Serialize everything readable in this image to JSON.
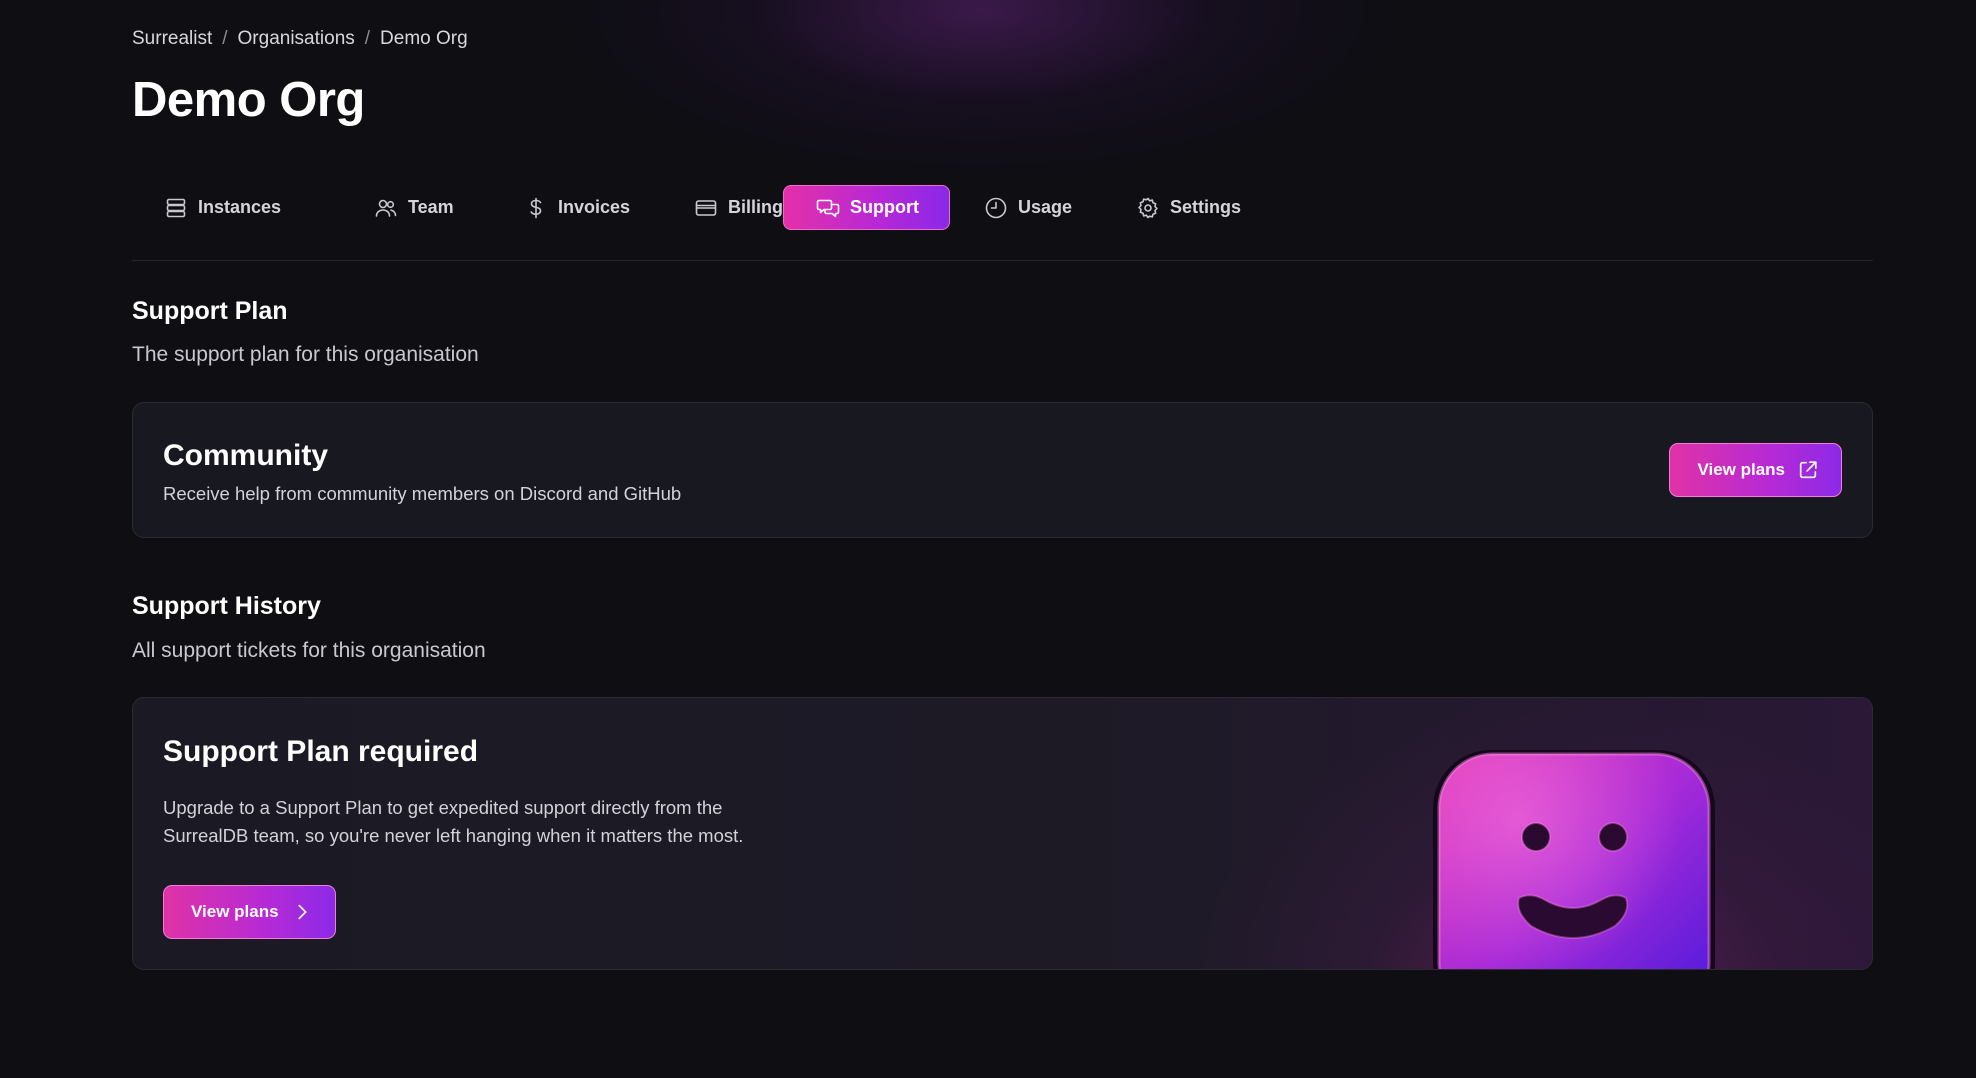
{
  "breadcrumb": {
    "items": [
      "Surrealist",
      "Organisations",
      "Demo Org"
    ],
    "separator": "/"
  },
  "page_title": "Demo Org",
  "tabs": [
    {
      "label": "Instances",
      "icon": "server-stack-icon",
      "active": false
    },
    {
      "label": "Team",
      "icon": "users-icon",
      "active": false
    },
    {
      "label": "Invoices",
      "icon": "dollar-icon",
      "active": false
    },
    {
      "label": "Billing",
      "icon": "credit-card-icon",
      "active": false
    },
    {
      "label": "Support",
      "icon": "chat-bubbles-icon",
      "active": true
    },
    {
      "label": "Usage",
      "icon": "clock-icon",
      "active": false
    },
    {
      "label": "Settings",
      "icon": "gear-icon",
      "active": false
    }
  ],
  "support_plan": {
    "title": "Support Plan",
    "subtitle": "The support plan for this organisation",
    "plan_name": "Community",
    "plan_description": "Receive help from community members on Discord and GitHub",
    "button_label": "View plans",
    "button_icon": "external-link-icon"
  },
  "support_history": {
    "title": "Support History",
    "subtitle": "All support tickets for this organisation",
    "card_title": "Support Plan required",
    "card_description": "Upgrade to a Support Plan to get expedited support directly from the SurrealDB team, so you're never left hanging when it matters the most.",
    "button_label": "View plans",
    "button_icon": "chevron-right-icon",
    "illustration": "smiley-cube-illustration"
  },
  "colors": {
    "accent_start": "#e032a6",
    "accent_end": "#8c2ae6",
    "background": "#0e0e13",
    "card": "#181820"
  }
}
